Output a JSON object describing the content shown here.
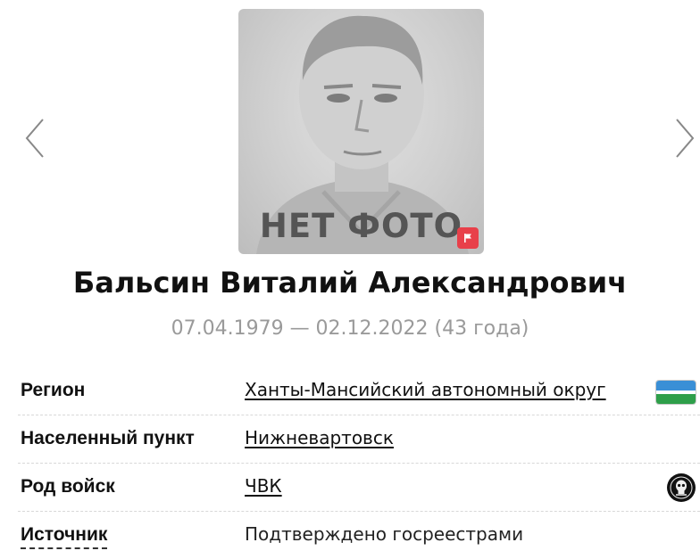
{
  "photo": {
    "placeholder_text": "НЕТ ФОТО",
    "flag_icon": "flag-icon",
    "flag_color": "#e8404a"
  },
  "person": {
    "name": "Бальсин Виталий Александрович",
    "dates": "07.04.1979 — 02.12.2022 (43 года)"
  },
  "details": [
    {
      "label": "Регион",
      "value": "Ханты-Мансийский автономный округ",
      "icon": "region-flag-icon"
    },
    {
      "label": "Населенный пункт",
      "value": "Нижневартовск"
    },
    {
      "label": "Род войск",
      "value": "ЧВК",
      "icon": "skull-emblem-icon"
    },
    {
      "label": "Источник",
      "value": "Подтверждено госреестрами"
    }
  ],
  "colors": {
    "dates_text": "#9a9a9a",
    "flag_blue": "#3a8fd6",
    "flag_green": "#2e9f4a"
  }
}
